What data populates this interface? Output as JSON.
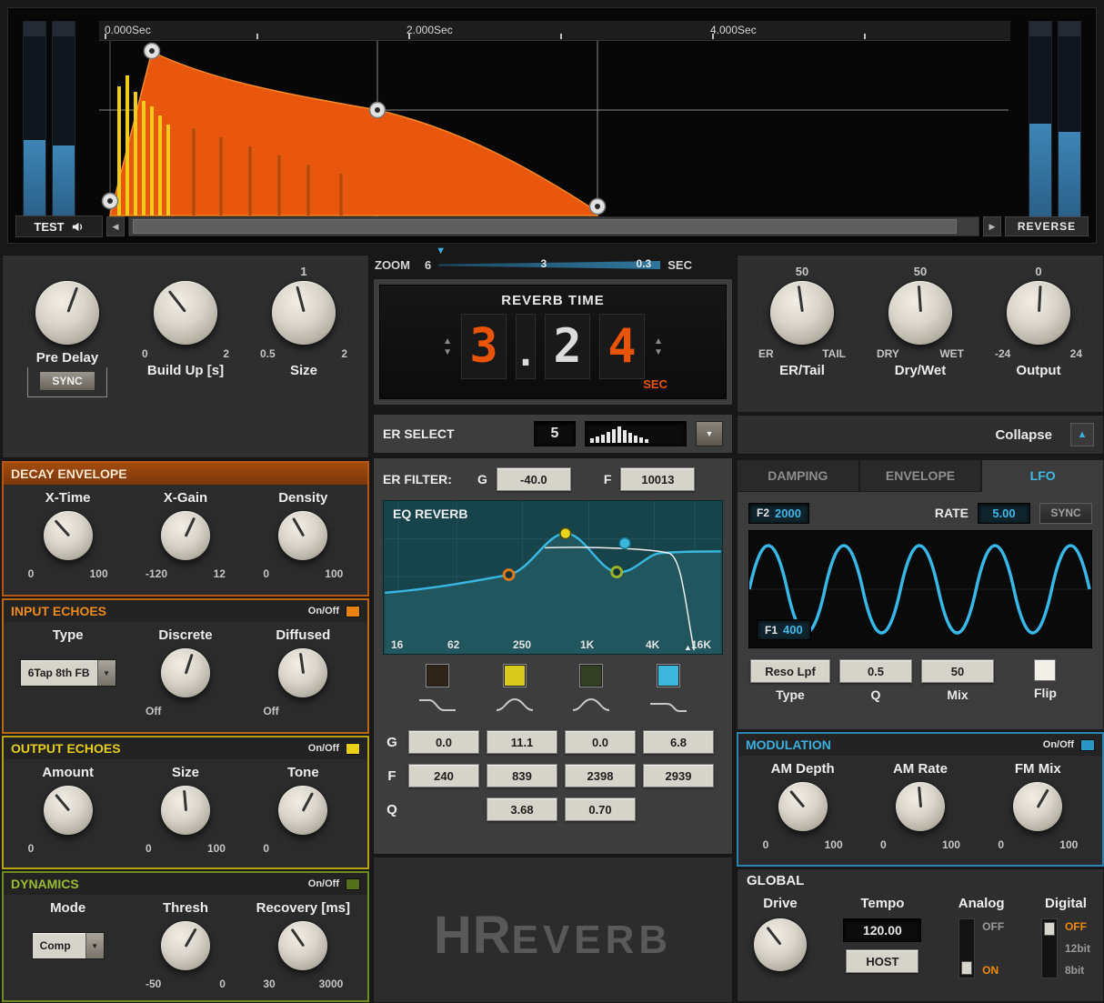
{
  "icons": {
    "left_arrow": "◀",
    "right_arrow": "▶",
    "up_arrow": "▲",
    "down_arrow": "▼",
    "zoom_marker": "▼",
    "collapse_up": "▲"
  },
  "display": {
    "time_labels": [
      "0.000Sec",
      "2.000Sec",
      "4.000Sec"
    ],
    "test_label": "TEST",
    "reverse_label": "REVERSE"
  },
  "zoom": {
    "label": "ZOOM",
    "tick_left": "6",
    "tick_mid": "3",
    "tick_right": "0.3",
    "unit": "SEC"
  },
  "reverb_time": {
    "title": "REVERB TIME",
    "digit1": "3",
    "dot": ".",
    "digit2": "2",
    "digit3": "4",
    "unit": "SEC"
  },
  "er_select": {
    "label": "ER SELECT",
    "value": "5"
  },
  "main_knobs": {
    "pre_delay": {
      "label": "Pre Delay",
      "sync": "SYNC"
    },
    "build_up": {
      "label": "Build Up [s]",
      "min": "0",
      "max": "2"
    },
    "size": {
      "label": "Size",
      "min": "0.5",
      "max": "2",
      "value": "1"
    },
    "er_tail": {
      "label": "ER/Tail",
      "min": "ER",
      "max": "TAIL",
      "value": "50"
    },
    "dry_wet": {
      "label": "Dry/Wet",
      "min": "DRY",
      "max": "WET",
      "value": "50"
    },
    "output": {
      "label": "Output",
      "min": "-24",
      "max": "24",
      "value": "0"
    }
  },
  "decay_envelope": {
    "title": "DECAY ENVELOPE",
    "knobs": [
      {
        "label": "X-Time",
        "min": "0",
        "max": "100"
      },
      {
        "label": "X-Gain",
        "min": "-120",
        "max": "12"
      },
      {
        "label": "Density",
        "min": "0",
        "max": "100"
      }
    ]
  },
  "input_echoes": {
    "title": "INPUT ECHOES",
    "onoff": "On/Off",
    "type": {
      "label": "Type",
      "value": "6Tap 8th FB"
    },
    "knobs": [
      {
        "label": "Discrete",
        "min": "Off",
        "max": ""
      },
      {
        "label": "Diffused",
        "min": "Off",
        "max": ""
      }
    ]
  },
  "output_echoes": {
    "title": "OUTPUT ECHOES",
    "onoff": "On/Off",
    "knobs": [
      {
        "label": "Amount",
        "min": "0",
        "max": ""
      },
      {
        "label": "Size",
        "min": "0",
        "max": "100"
      },
      {
        "label": "Tone",
        "min": "0",
        "max": ""
      }
    ]
  },
  "dynamics": {
    "title": "DYNAMICS",
    "onoff": "On/Off",
    "mode": {
      "label": "Mode",
      "value": "Comp"
    },
    "knobs": [
      {
        "label": "Thresh",
        "min": "-50",
        "max": "0"
      },
      {
        "label": "Recovery [ms]",
        "min": "30",
        "max": "3000"
      }
    ]
  },
  "er_filter": {
    "label": "ER FILTER:",
    "g_label": "G",
    "g_value": "-40.0",
    "f_label": "F",
    "f_value": "10013"
  },
  "eq": {
    "title": "EQ REVERB",
    "freq_labels": [
      "16",
      "62",
      "250",
      "1K",
      "4K",
      "16K"
    ],
    "row_labels": {
      "g": "G",
      "f": "F",
      "q": "Q"
    },
    "g_values": [
      "0.0",
      "11.1",
      "0.0",
      "6.8"
    ],
    "f_values": [
      "240",
      "839",
      "2398",
      "2939"
    ],
    "q_values": [
      "3.68",
      "0.70"
    ],
    "band_styles": [
      "background:#2e2418",
      "background:#d9cb1e",
      "background:#333f22",
      "background:#3cb6da"
    ]
  },
  "logo": {
    "h": "H",
    "r": "R",
    "rest": "EVERB"
  },
  "collapse": {
    "label": "Collapse"
  },
  "tabs": [
    {
      "label": "DAMPING"
    },
    {
      "label": "ENVELOPE"
    },
    {
      "label": "LFO"
    }
  ],
  "lfo": {
    "f2_label": "F2",
    "f2_value": "2000",
    "rate_label": "RATE",
    "rate_value": "5.00",
    "sync": "SYNC",
    "f1_label": "F1",
    "f1_value": "400",
    "type_value": "Reso Lpf",
    "q_value": "0.5",
    "mix_value": "50",
    "type_label": "Type",
    "q_label": "Q",
    "mix_label": "Mix",
    "flip_label": "Flip"
  },
  "modulation": {
    "title": "MODULATION",
    "onoff": "On/Off",
    "knobs": [
      {
        "label": "AM Depth",
        "min": "0",
        "max": "100"
      },
      {
        "label": "AM Rate",
        "min": "0",
        "max": "100"
      },
      {
        "label": "FM Mix",
        "min": "0",
        "max": "100"
      }
    ]
  },
  "global": {
    "title": "GLOBAL",
    "drive_label": "Drive",
    "tempo_label": "Tempo",
    "tempo_value": "120.00",
    "host_label": "HOST",
    "analog_label": "Analog",
    "analog_options": [
      "OFF",
      "ON"
    ],
    "digital_label": "Digital",
    "digital_options": [
      "OFF",
      "12bit",
      "8bit"
    ]
  }
}
